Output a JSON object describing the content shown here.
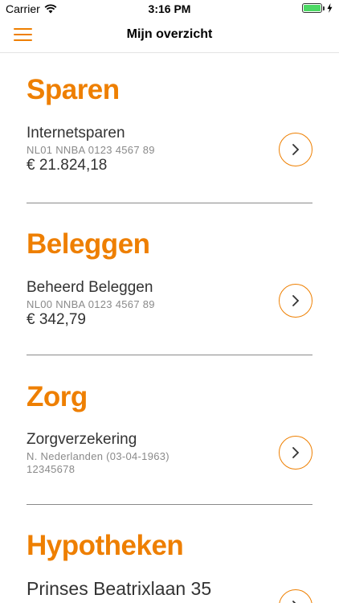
{
  "status_bar": {
    "carrier": "Carrier",
    "time": "3:16 PM",
    "battery_level": 1.0
  },
  "nav": {
    "title": "Mijn overzicht"
  },
  "sections": [
    {
      "title": "Sparen",
      "account": {
        "name": "Internetsparen",
        "line1": "NL01 NNBA 0123 4567 89",
        "line2": "€ 21.824,18"
      }
    },
    {
      "title": "Beleggen",
      "account": {
        "name": "Beheerd Beleggen",
        "line1": "NL00 NNBA 0123 4567 89",
        "line2": "€ 342,79"
      }
    },
    {
      "title": "Zorg",
      "account": {
        "name": "Zorgverzekering",
        "line1": "N. Nederlanden (03-04-1963)",
        "line2": "12345678"
      }
    },
    {
      "title": "Hypotheken",
      "account": {
        "name": "Prinses Beatrixlaan 35"
      }
    }
  ],
  "colors": {
    "accent": "#ee7f00",
    "text": "#333333",
    "muted": "#8a8a8a",
    "divider": "#8a8a8a"
  },
  "icons": {
    "menu": "hamburger-icon",
    "chevron": "chevron-right-icon"
  }
}
